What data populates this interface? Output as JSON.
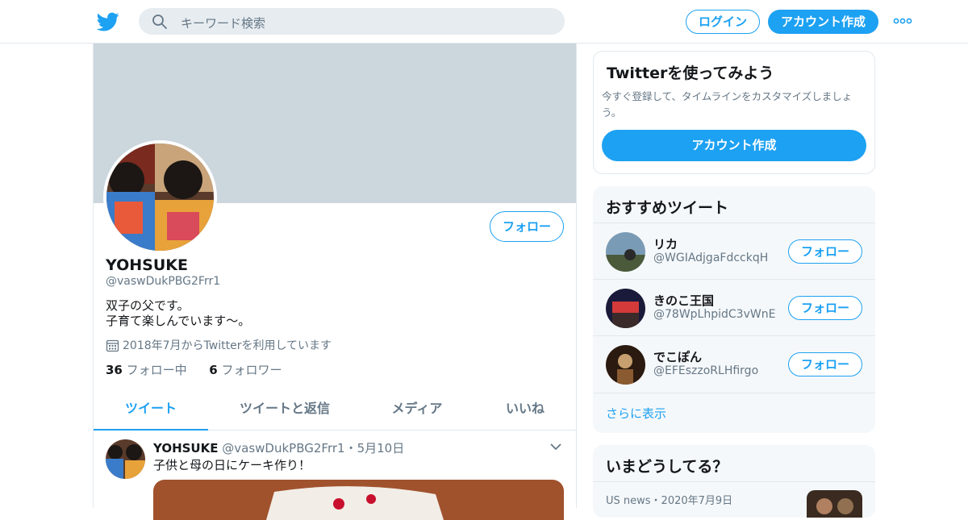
{
  "header": {
    "search_placeholder": "キーワード検索",
    "login_label": "ログイン",
    "signup_label": "アカウント作成"
  },
  "profile": {
    "follow_label": "フォロー",
    "name": "YOHSUKE",
    "handle": "@vaswDukPBG2Frr1",
    "bio_line1": "双子の父です。",
    "bio_line2": "子育て楽しんでいます～。",
    "joined": "2018年7月からTwitterを利用しています",
    "following_count": "36",
    "following_label": "フォロー中",
    "followers_count": "6",
    "followers_label": "フォロワー"
  },
  "tabs": [
    {
      "label": "ツイート"
    },
    {
      "label": "ツイートと返信"
    },
    {
      "label": "メディア"
    },
    {
      "label": "いいね"
    }
  ],
  "tweet": {
    "name": "YOHSUKE",
    "meta": "@vaswDukPBG2Frr1・5月10日",
    "text": "子供と母の日にケーキ作り！"
  },
  "signup_card": {
    "title": "Twitterを使ってみよう",
    "text": "今すぐ登録して、タイムラインをカスタマイズしましょう。",
    "button_label": "アカウント作成"
  },
  "recommend": {
    "title": "おすすめツイート",
    "follow_label": "フォロー",
    "show_more": "さらに表示",
    "users": [
      {
        "name": "リカ",
        "handle": "@WGIAdjgaFdcckqH"
      },
      {
        "name": "きのこ王国",
        "handle": "@78WpLhpidC3vWnE"
      },
      {
        "name": "でこぽん",
        "handle": "@EFEszzoRLHfirgo"
      }
    ]
  },
  "trends": {
    "title": "いまどうしてる？",
    "source": "US news・2020年7月9日"
  },
  "colors": {
    "accent": "#1da1f2",
    "banner": "#ccd6dd",
    "panel": "#f5f8fa",
    "secondary_text": "#657786"
  }
}
